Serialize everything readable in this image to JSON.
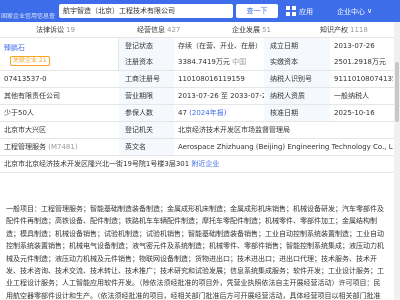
{
  "header": {
    "logo_text": "国家企业信用信息查询",
    "search_value": "航宇智造（北京）工程技术有限公司",
    "search_button": "查一下",
    "apps_label": "应用",
    "center_label": "企业中心",
    "more_symbol": "∨"
  },
  "tabs": [
    {
      "label": "法律诉讼",
      "count": "19"
    },
    {
      "label": "经营信息",
      "count": "427"
    },
    {
      "label": "企业发展",
      "count": "51"
    },
    {
      "label": "知识产权",
      "count": "1118"
    }
  ],
  "rows": {
    "r1": {
      "c1": "臻鹏石",
      "c1_tag": "关联企业 21",
      "l2": "登记状态",
      "v2": "存续（在营、开业、在册）",
      "l3": "成立日期",
      "v3": "2013-07-26"
    },
    "r2": {
      "l2": "注册资本",
      "v2": "3384.7419万元",
      "v2b": "中国",
      "l3": "实缴资本",
      "v3": "2501.2918万元"
    },
    "r3": {
      "c1": "07413537-0",
      "l2": "工商注册号",
      "v2": "110108016119159",
      "l3": "纳税人识别号",
      "v3": "91110108074135"
    },
    "r4": {
      "c1": "其他有限责任公司",
      "l2": "营业期限",
      "v2": "2013-07-26 至 2033-07-25",
      "l3": "纳税人资质",
      "v3": "一般纳税人"
    },
    "r5": {
      "c1": "少于50人",
      "l2": "参保人数",
      "v2": "47",
      "v2b": "(2024年报)",
      "l3": "核准日期",
      "v3": "2025-10-16"
    },
    "r6": {
      "c1": "北京市大兴区",
      "l2": "登记机关",
      "v2": "北京经济技术开发区市场监督管理局"
    },
    "r7": {
      "c1": "工程管理服务",
      "c1b": "(M7481)",
      "l2": "英文名",
      "v2": "Aerospace Zhizhuang (Beijing) Engineering Technology Co., Lt"
    },
    "r8": {
      "c1": "北京市北京经济技术开发区隆兴北一街19号院1号楼3层301",
      "c1b": "附近企业"
    }
  },
  "scope_text": "一般项目：工程管理服务；智能基础制造装备制造；金属成形机床制造；金属成形机床销售；机械设备研发；汽车零部件及配件件再制造；高铁设备、配件制造；铁路机车车辆配件制造；摩托车零配件制造；机械零件、零部件加工；金属结构制造；模具制造；机械设备销售；试验机制造；试验机销售；智能基础制造装备销售；工业自动控制系统装置制造；工业自动控制系统装置销售；机械电气设备制造；液气密元件及系统制造；机械零件、零部件销售；智能控制系统集成；液压动力机械及元件制造；液压动力机械及元件销售；物联网设备制造；货物进出口；技术进出口；进出口代理；技术服务、技术开发、技术咨询、技术交流、技术转让、技术推广；技术研究和试验发展；信息系统集成服务；软件开发；工业设计服务；工业工程设计服务；人工智能应用软件开发。（除依法须经批准的项目外，凭营业执照依法自主开展经营活动）许可项目：民用航空器零部件设计和生产。（依法须经批准的项目，经相关部门批准后方可开展经营活动，具体经营项目以相关部门批准文件或许可证件为准）（不得从事国家和本市产业政策禁止和限制类项目的经营活动。）"
}
